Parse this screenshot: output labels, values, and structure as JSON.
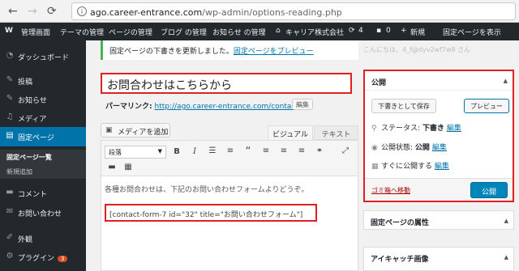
{
  "browser": {
    "url_domain": "ago.career-entrance.com",
    "url_path": "/wp-admin/options-reading.php"
  },
  "adminbar": {
    "wp_logo": "W",
    "items": [
      "管理画面",
      "テーマの管理",
      "ページの管理",
      "ブログ の管理",
      "お知らせ の管理",
      "キャリア株式会社",
      "4",
      "0",
      "新規",
      "固定ページを表示"
    ]
  },
  "sidebar": {
    "items": [
      {
        "label": "ダッシュボード",
        "icon": "dashboard-icon"
      },
      {
        "label": "投稿",
        "icon": "pin-icon"
      },
      {
        "label": "お知らせ",
        "icon": "pin-icon"
      },
      {
        "label": "メディア",
        "icon": "media-icon"
      },
      {
        "label": "固定ページ",
        "icon": "page-icon"
      },
      {
        "label": "コメント",
        "icon": "comment-icon"
      },
      {
        "label": "お問い合わせ",
        "icon": "mail-icon"
      },
      {
        "label": "外観",
        "icon": "brush-icon"
      },
      {
        "label": "プラグイン",
        "icon": "plugin-icon",
        "badge": "3"
      }
    ],
    "submenu": [
      "固定ページ一覧",
      "新規追加"
    ]
  },
  "notice": {
    "text": "固定ページの下書きを更新しました。",
    "link": "固定ページをプレビュー"
  },
  "ghost_text": "こんにちは、4_f@dyv2wf7w8 さん",
  "post": {
    "title": "お問合わせはこちらから",
    "permalink_label": "パーマリンク:",
    "permalink_url": "http://ago.career-entrance.com/contact/",
    "edit_button": "編集"
  },
  "editor": {
    "media_button": "メディアを追加",
    "tab_visual": "ビジュアル",
    "tab_text": "テキスト",
    "format_select": "段落",
    "body_text": "各種お問合わせは、下記のお問い合わせフォームよりどうぞ。",
    "shortcode": "[contact-form-7 id=\"32\" title=\"お問い合わせフォーム\"]"
  },
  "publish": {
    "title": "公開",
    "save_draft": "下書きとして保存",
    "preview": "プレビュー",
    "status_label": "ステータス:",
    "status_value": "下書き",
    "visibility_label": "公開状態:",
    "visibility_value": "公開",
    "schedule_label": "すぐに公開する",
    "edit_link": "編集",
    "trash": "ゴミ箱へ移動",
    "publish_button": "公開"
  },
  "attributes_box": {
    "title": "固定ページの属性"
  },
  "featured_box": {
    "title": "アイキャッチ画像"
  },
  "colors": {
    "accent": "#0073aa",
    "highlight": "#e02020",
    "admin": "#23282d"
  }
}
